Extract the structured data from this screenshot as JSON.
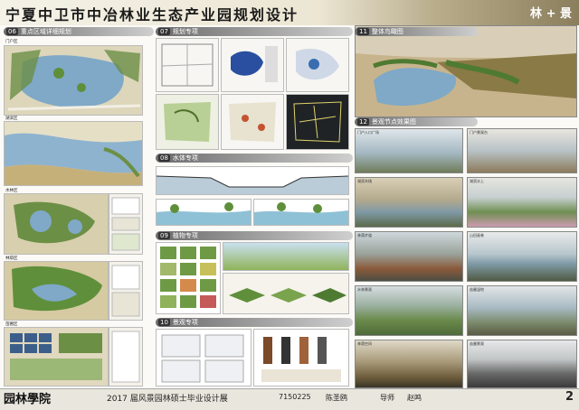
{
  "header": {
    "title": "宁夏中卫市中冶林业生态产业园规划设计",
    "badge": "林 + 景"
  },
  "sections": {
    "s06": {
      "num": "06",
      "title": "重点区域详细规划"
    },
    "s07": {
      "num": "07",
      "title": "规划专项"
    },
    "s08": {
      "num": "08",
      "title": "水体专项"
    },
    "s09": {
      "num": "09",
      "title": "植物专项"
    },
    "s10": {
      "num": "10",
      "title": "景观专项"
    },
    "s11": {
      "num": "11",
      "title": "整体鸟瞰图"
    },
    "s12": {
      "num": "12",
      "title": "景观节点效果图"
    }
  },
  "left_labels": [
    "门户区",
    "湖滨区",
    "水林区",
    "林荫区",
    "苗圃区"
  ],
  "photo_labels": [
    "门户入口广场",
    "门户景观台",
    "湖滨木栈",
    "湖滨水上",
    "林荫步道",
    "山田画卷",
    "水林景观",
    "苗圃湿地",
    "林荫空间",
    "苗圃景观"
  ],
  "footer": {
    "logo": "园林學院",
    "exhibition": "2017 届风景园林硕士毕业设计展",
    "student_id": "7150225",
    "student_name": "陈圣鸥",
    "advisor_label": "导师",
    "advisor_name": "赵鸣",
    "page": "2"
  },
  "colors": {
    "water": "#7fa9c7",
    "green": "#5f8f3a",
    "dark": "#2d2d2d",
    "sand": "#d9c9a3"
  }
}
